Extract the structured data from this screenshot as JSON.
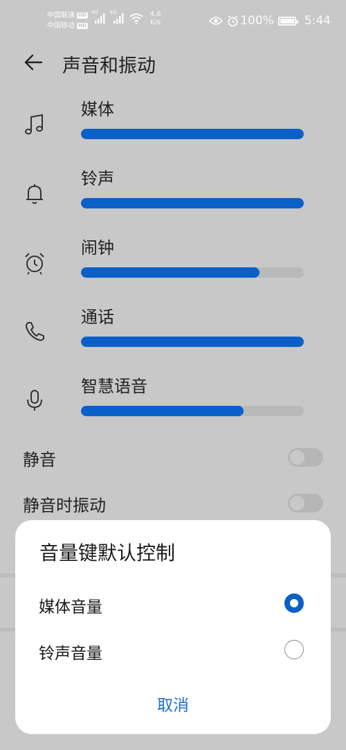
{
  "status_bar": {
    "carrier_1": "中国联通",
    "carrier_2": "中国移动",
    "hd_badge": "HD",
    "net_type_1": "4G",
    "net_type_2": "4G",
    "net_speed_value": "4.6",
    "net_speed_unit": "K/s",
    "battery_percent": "100%",
    "time": "5:44",
    "icons": [
      "eye-icon",
      "alarm-icon",
      "battery-icon",
      "wifi-icon",
      "signal-icon"
    ]
  },
  "header": {
    "back_icon": "back-arrow-icon",
    "title": "声音和振动"
  },
  "volumes": [
    {
      "label": "媒体",
      "icon": "music-note-icon",
      "level_pct": 100
    },
    {
      "label": "铃声",
      "icon": "bell-icon",
      "level_pct": 100
    },
    {
      "label": "闹钟",
      "icon": "alarm-clock-icon",
      "level_pct": 80
    },
    {
      "label": "通话",
      "icon": "phone-icon",
      "level_pct": 100
    },
    {
      "label": "智慧语音",
      "icon": "microphone-icon",
      "level_pct": 73
    }
  ],
  "switches": [
    {
      "label": "静音",
      "on": false
    },
    {
      "label": "静音时振动",
      "on": false
    }
  ],
  "dialog": {
    "title": "音量键默认控制",
    "options": [
      {
        "label": "媒体音量",
        "selected": true
      },
      {
        "label": "铃声音量",
        "selected": false
      }
    ],
    "cancel_label": "取消"
  },
  "colors": {
    "accent": "#0a60c8",
    "scrim_background": "#c8c8c8",
    "dialog_bg": "#ffffff"
  }
}
